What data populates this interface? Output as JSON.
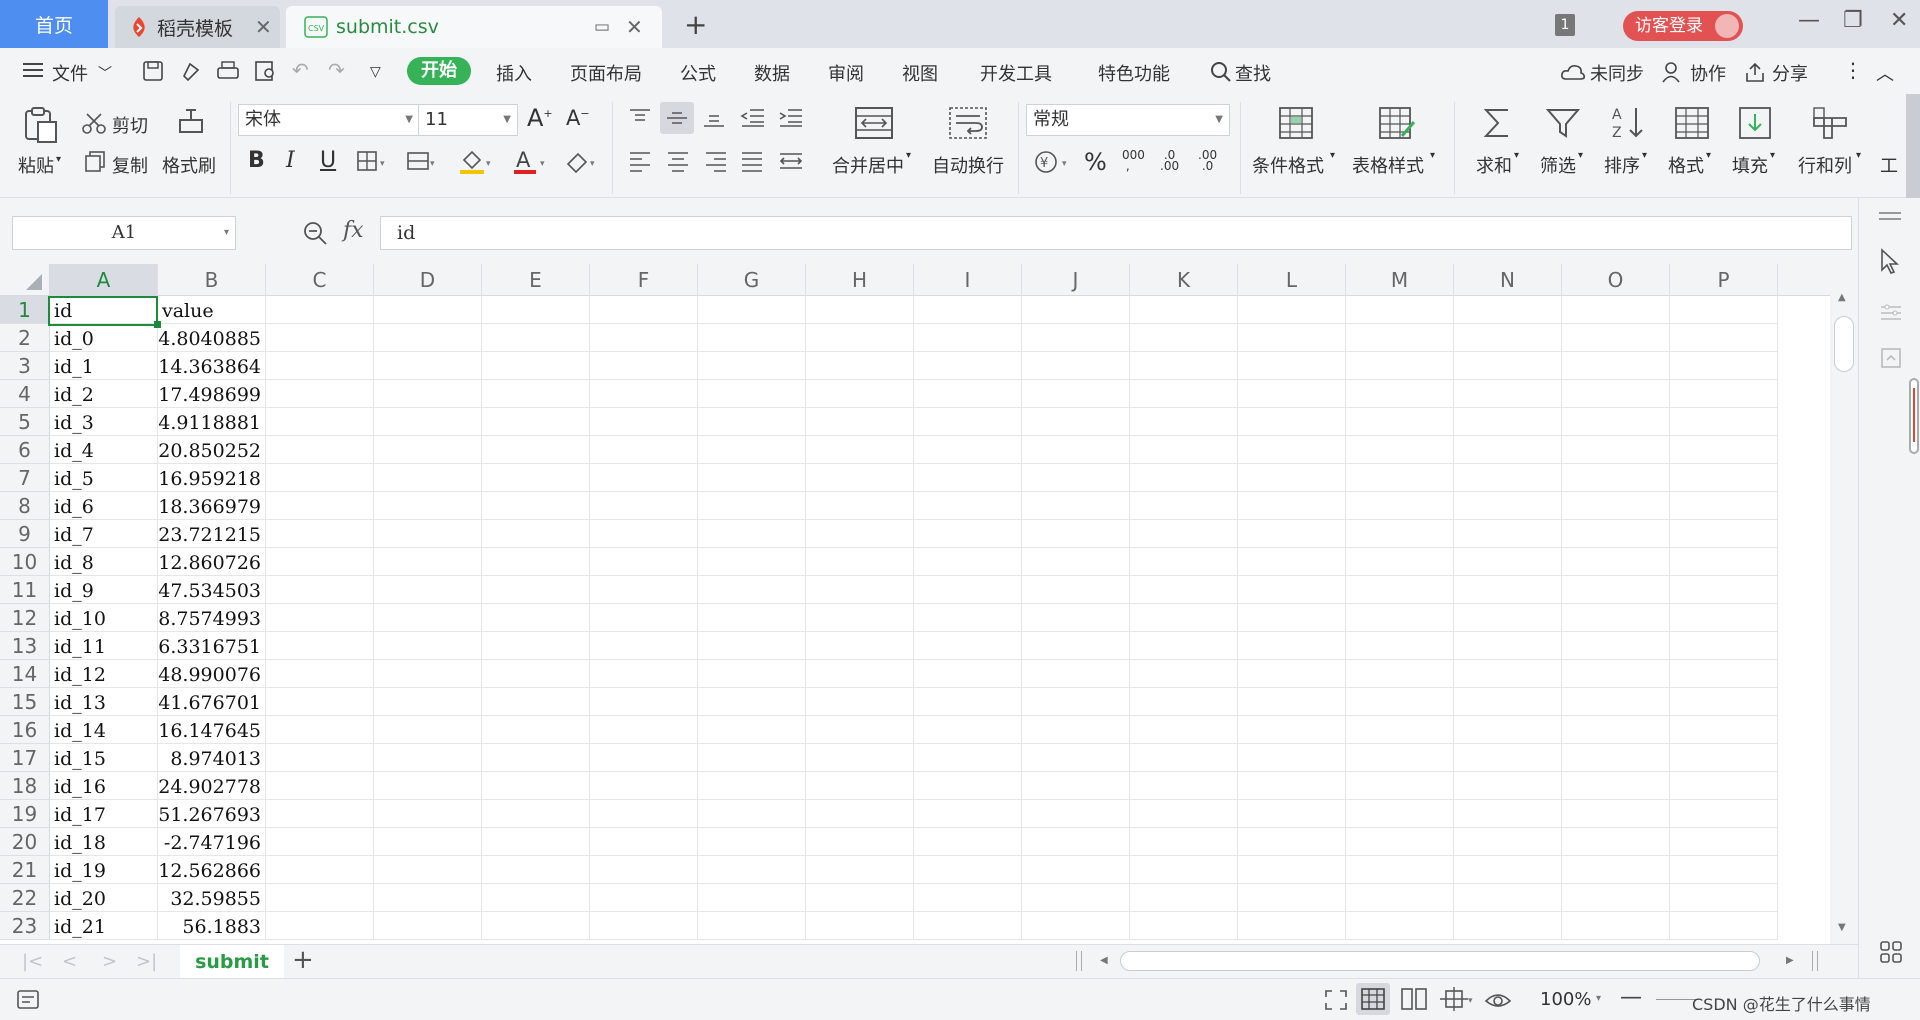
{
  "tabs": {
    "home": "首页",
    "template": "稻壳模板",
    "file": "submit.csv",
    "file_icon": "CSV",
    "badge": "1",
    "login": "访客登录"
  },
  "menu": {
    "file": "文件",
    "start": "开始",
    "insert": "插入",
    "layout": "页面布局",
    "formula": "公式",
    "data": "数据",
    "review": "审阅",
    "view": "视图",
    "dev": "开发工具",
    "special": "特色功能",
    "search": "查找",
    "sync": "未同步",
    "collab": "协作",
    "share": "分享"
  },
  "ribbon": {
    "paste": "粘贴",
    "cut": "剪切",
    "copy": "复制",
    "format_painter": "格式刷",
    "font_name": "宋体",
    "font_size": "11",
    "bold": "B",
    "italic": "I",
    "underline": "U",
    "merge": "合并居中",
    "wrap": "自动换行",
    "number_format": "常规",
    "cond_format": "条件格式",
    "table_style": "表格样式",
    "sum": "求和",
    "filter": "筛选",
    "sort": "排序",
    "format": "格式",
    "fill": "填充",
    "rowcol": "行和列",
    "more": "工"
  },
  "formula_bar": {
    "name_box": "A1",
    "fx": "fx",
    "content": "id"
  },
  "columns": [
    "A",
    "B",
    "C",
    "D",
    "E",
    "F",
    "G",
    "H",
    "I",
    "J",
    "K",
    "L",
    "M",
    "N",
    "O",
    "P"
  ],
  "rows": [
    {
      "n": "1",
      "a": "id",
      "b": "value"
    },
    {
      "n": "2",
      "a": "id_0",
      "b": "4.8040885"
    },
    {
      "n": "3",
      "a": "id_1",
      "b": "14.363864"
    },
    {
      "n": "4",
      "a": "id_2",
      "b": "17.498699"
    },
    {
      "n": "5",
      "a": "id_3",
      "b": "4.9118881"
    },
    {
      "n": "6",
      "a": "id_4",
      "b": "20.850252"
    },
    {
      "n": "7",
      "a": "id_5",
      "b": "16.959218"
    },
    {
      "n": "8",
      "a": "id_6",
      "b": "18.366979"
    },
    {
      "n": "9",
      "a": "id_7",
      "b": "23.721215"
    },
    {
      "n": "10",
      "a": "id_8",
      "b": "12.860726"
    },
    {
      "n": "11",
      "a": "id_9",
      "b": "47.534503"
    },
    {
      "n": "12",
      "a": "id_10",
      "b": "8.7574993"
    },
    {
      "n": "13",
      "a": "id_11",
      "b": "6.3316751"
    },
    {
      "n": "14",
      "a": "id_12",
      "b": "48.990076"
    },
    {
      "n": "15",
      "a": "id_13",
      "b": "41.676701"
    },
    {
      "n": "16",
      "a": "id_14",
      "b": "16.147645"
    },
    {
      "n": "17",
      "a": "id_15",
      "b": "8.974013"
    },
    {
      "n": "18",
      "a": "id_16",
      "b": "24.902778"
    },
    {
      "n": "19",
      "a": "id_17",
      "b": "51.267693"
    },
    {
      "n": "20",
      "a": "id_18",
      "b": "-2.747196"
    },
    {
      "n": "21",
      "a": "id_19",
      "b": "12.562866"
    },
    {
      "n": "22",
      "a": "id_20",
      "b": "32.59855"
    },
    {
      "n": "23",
      "a": "id_21",
      "b": "56.1883"
    }
  ],
  "sheet": {
    "name": "submit"
  },
  "status": {
    "zoom": "100%",
    "watermark": "CSDN @花生了什么事情"
  },
  "colors": {
    "accent_green": "#36b359",
    "home_tab": "#4e8ef0",
    "login_red": "#e25252",
    "selection": "#1f8a3b"
  }
}
